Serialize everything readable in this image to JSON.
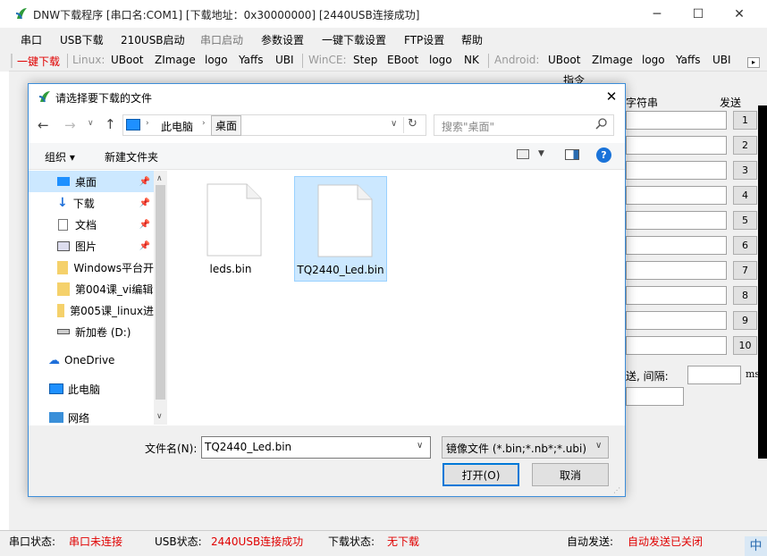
{
  "app": {
    "title": "DNW下载程序 [串口名:COM1] [下载地址：0x30000000]  [2440USB连接成功]",
    "minimize": "─",
    "maximize": "☐",
    "close": "✕"
  },
  "menu": [
    "串口",
    "USB下载",
    "210USB启动",
    "串口启动",
    "参数设置",
    "一键下载设置",
    "FTP设置",
    "帮助"
  ],
  "toolbar": {
    "one_key": "一键下载",
    "linux_label": "Linux:",
    "linux_items": [
      "UBoot",
      "ZImage",
      "logo",
      "Yaffs",
      "UBI"
    ],
    "wince_label": "WinCE:",
    "wince_items": [
      "Step",
      "EBoot",
      "logo",
      "NK"
    ],
    "android_label": "Android:",
    "android_items": [
      "UBoot",
      "ZImage",
      "logo",
      "Yaffs",
      "UBI"
    ]
  },
  "right_panel": {
    "commands_label": "指令",
    "string_label": "字符串",
    "send_label": "发送",
    "buttons": [
      "1",
      "2",
      "3",
      "4",
      "5",
      "6",
      "7",
      "8",
      "9",
      "10"
    ],
    "interval_label": "送, 间隔:",
    "ms_label": "ms"
  },
  "status": {
    "serial_label": "串口状态:",
    "serial_value": "串口未连接",
    "usb_label": "USB状态:",
    "usb_value": "2440USB连接成功",
    "download_label": "下载状态:",
    "download_value": "无下载",
    "auto_label": "自动发送:",
    "auto_value": "自动发送已关闭",
    "ime": "中"
  },
  "dialog": {
    "title": "请选择要下载的文件",
    "close": "✕",
    "breadcrumb": [
      "此电脑",
      "桌面"
    ],
    "search_placeholder": "搜索\"桌面\"",
    "organize": "组织 ▾",
    "new_folder": "新建文件夹",
    "nav": [
      {
        "label": "桌面",
        "icon": "desktop-icon",
        "pinned": true
      },
      {
        "label": "下载",
        "icon": "download-icon",
        "pinned": true
      },
      {
        "label": "文档",
        "icon": "document-icon",
        "pinned": true
      },
      {
        "label": "图片",
        "icon": "picture-icon",
        "pinned": true
      },
      {
        "label": "Windows平台开",
        "icon": "folder-icon"
      },
      {
        "label": "第004课_vi编辑",
        "icon": "folder-icon"
      },
      {
        "label": "第005课_linux进",
        "icon": "folder-icon"
      },
      {
        "label": "新加卷 (D:)",
        "icon": "drive-icon"
      },
      {
        "label": "OneDrive",
        "icon": "cloud-icon"
      },
      {
        "label": "此电脑",
        "icon": "computer-icon"
      },
      {
        "label": "网络",
        "icon": "network-icon"
      }
    ],
    "files": [
      "leds.bin",
      "TQ2440_Led.bin"
    ],
    "filename_label": "文件名(N):",
    "filename_value": "TQ2440_Led.bin",
    "filetype": "镜像文件 (*.bin;*.nb*;*.ubi)",
    "open": "打开(O)",
    "cancel": "取消"
  }
}
